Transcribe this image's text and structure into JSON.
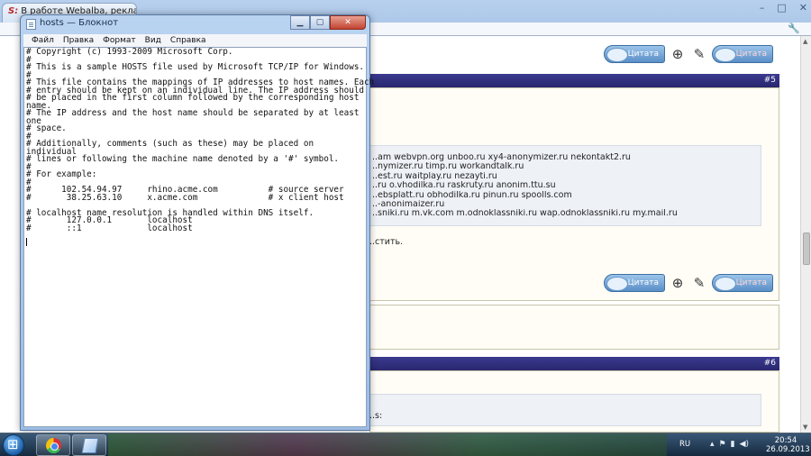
{
  "browser": {
    "tab_title": "В работе Webalba, рекла",
    "favicon": "S:",
    "window_controls": [
      "–",
      "□",
      "✕"
    ],
    "menu_icon": "wrench-icon"
  },
  "page": {
    "post_number_1": "#5",
    "post_number_2": "#6",
    "quote_label": "Цитата",
    "links": [
      "..am webvpn.org unboo.ru xy4-anonymizer.ru nekontakt2.ru",
      "..nymizer.ru timp.ru workandtalk.ru",
      "..est.ru waitplay.ru nezayti.ru",
      "..ru o.vhodilka.ru raskruty.ru anonim.ttu.su",
      "..ebsplatt.ru obhodilka.ru pinun.ru spoolls.com",
      "..-anonimaizer.ru",
      "..snikі.ru m.vk.com m.odnoklassniki.ru wap.odnoklassniki.ru my.mail.ru"
    ],
    "stub_text": "..стить.",
    "stub_text_2": "..s:"
  },
  "notepad": {
    "title": "hosts — Блокнот",
    "menu": [
      "Файл",
      "Правка",
      "Формат",
      "Вид",
      "Справка"
    ],
    "lines": [
      "# Copyright (c) 1993-2009 Microsoft Corp.",
      "#",
      "# This is a sample HOSTS file used by Microsoft TCP/IP for Windows.",
      "#",
      "# This file contains the mappings of IP addresses to host names. Each",
      "# entry should be kept on an individual line. The IP address should",
      "# be placed in the first column followed by the corresponding host",
      "name.",
      "# The IP address and the host name should be separated by at least",
      "one",
      "# space.",
      "#",
      "# Additionally, comments (such as these) may be placed on",
      "individual",
      "# lines or following the machine name denoted by a '#' symbol.",
      "#",
      "# For example:",
      "#",
      "#      102.54.94.97     rhino.acme.com          # source server",
      "#       38.25.63.10     x.acme.com              # x client host",
      "",
      "# localhost name resolution is handled within DNS itself.",
      "#       127.0.0.1       localhost",
      "#       ::1             localhost"
    ]
  },
  "taskbar": {
    "language": "RU",
    "time": "20:54",
    "date": "26.09.2013"
  }
}
